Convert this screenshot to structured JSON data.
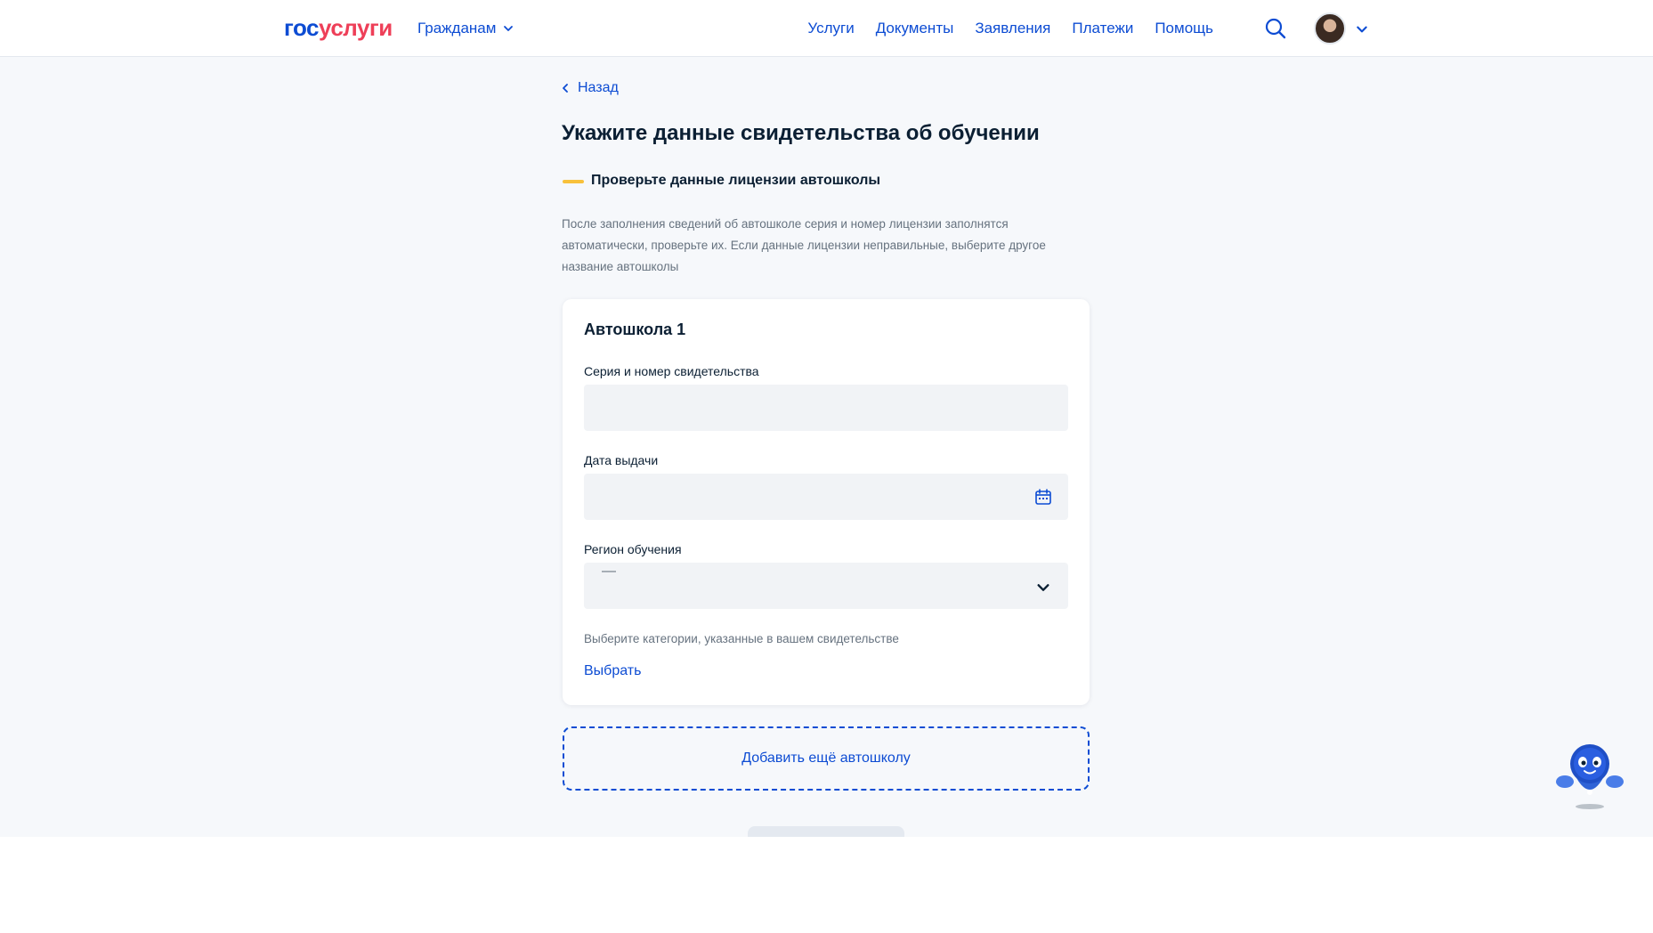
{
  "header": {
    "logo_part1": "гос",
    "logo_part2": "услуги",
    "audience_menu": "Гражданам",
    "nav": [
      "Услуги",
      "Документы",
      "Заявления",
      "Платежи",
      "Помощь"
    ]
  },
  "main": {
    "back_label": "Назад",
    "title": "Укажите данные свидетельства об обучении",
    "notice_title": "Проверьте данные лицензии автошколы",
    "notice_text": "После заполнения сведений об автошколе серия и номер лицензии заполнятся автоматически, проверьте их. Если данные лицензии неправильные, выберите другое название автошколы",
    "card": {
      "title": "Автошкола  1",
      "certificate_label": "Серия и номер свидетельства",
      "certificate_value": "",
      "issue_date_label": "Дата выдачи",
      "issue_date_value": "",
      "region_label": "Регион обучения",
      "region_value": "—",
      "categories_hint": "Выберите категории, указанные в вашем свидетельстве",
      "choose_label": "Выбрать"
    },
    "add_school_label": "Добавить ещё автошколу"
  },
  "colors": {
    "primary": "#0d4cd3",
    "brand_red": "#ee3f58",
    "accent_yellow": "#f8c13b",
    "background": "#f6f8fb",
    "field_bg": "#f1f3f6"
  },
  "icons": [
    "chevron-down-icon",
    "chevron-left-icon",
    "search-icon",
    "calendar-icon",
    "avatar",
    "assistant-robot-icon"
  ]
}
